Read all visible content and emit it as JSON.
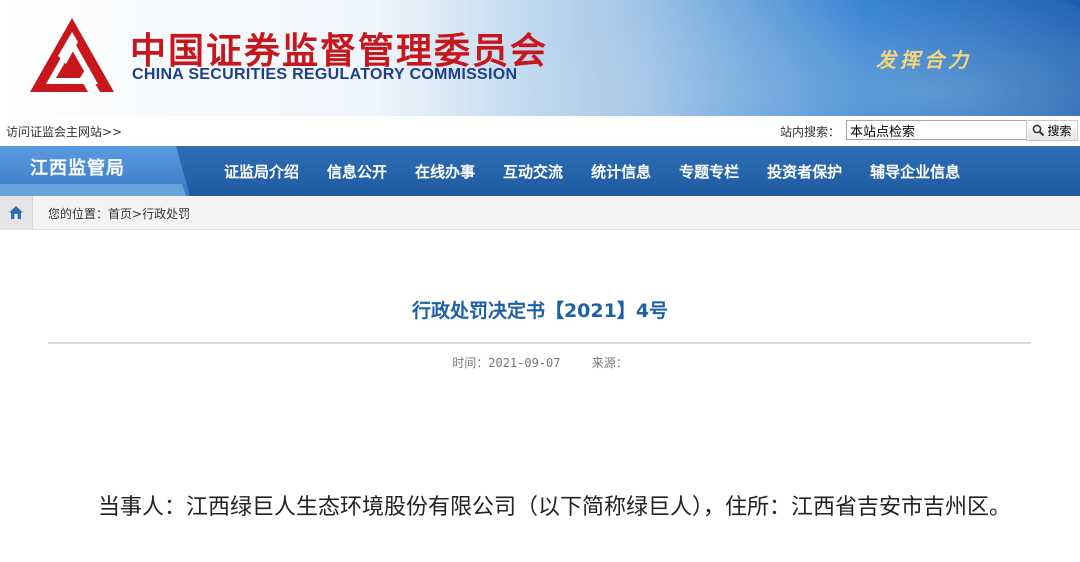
{
  "header": {
    "title_cn": "中国证券监督管理委员会",
    "title_en": "CHINA SECURITIES REGULATORY COMMISSION",
    "slogan": "发挥合力",
    "logo_icon": "csrc-logo-icon",
    "logo_color": "#c8161d"
  },
  "utility": {
    "visit_link": "访问证监会主网站>>",
    "search_label": "站内搜索：",
    "search_value": "本站点检索",
    "search_button": "搜索"
  },
  "nav": {
    "brand": "江西监管局",
    "items": [
      {
        "label": "证监局介绍"
      },
      {
        "label": "信息公开"
      },
      {
        "label": "在线办事"
      },
      {
        "label": "互动交流"
      },
      {
        "label": "统计信息"
      },
      {
        "label": "专题专栏"
      },
      {
        "label": "投资者保护"
      },
      {
        "label": "辅导企业信息"
      }
    ]
  },
  "breadcrumb": {
    "prefix": "您的位置：",
    "home": "首页",
    "separator": ">",
    "current": "行政处罚"
  },
  "article": {
    "title": "行政处罚决定书【2021】4号",
    "time_label": "时间：",
    "time": "2021-09-07",
    "source_label": "来源：",
    "source": "",
    "body": "当事人：江西绿巨人生态环境股份有限公司（以下简称绿巨人），住所：江西省吉安市吉州区。"
  },
  "colors": {
    "nav_bg": "#1f5aa0",
    "title_blue": "#1d5fa8",
    "brand_red": "#c8161d"
  }
}
